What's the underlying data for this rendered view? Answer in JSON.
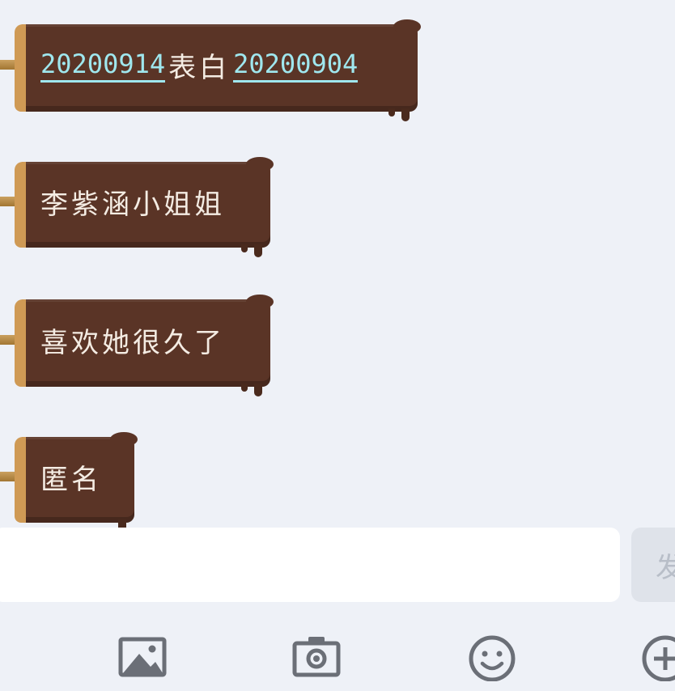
{
  "messages": [
    {
      "parts": [
        {
          "text": "20200914",
          "kind": "link"
        },
        {
          "text": "表白",
          "kind": "plain"
        },
        {
          "text": "20200904",
          "kind": "link"
        }
      ]
    },
    {
      "text": "李紫涵小姐姐"
    },
    {
      "text": "喜欢她很久了"
    },
    {
      "text": "匿名"
    }
  ],
  "input": {
    "value": "",
    "send_label": "发"
  },
  "toolbar": [
    "image-icon",
    "camera-icon",
    "emoji-icon",
    "plus-icon"
  ],
  "colors": {
    "bubble": "#5a3426",
    "stick": "#cf9a55",
    "link": "#9fe7ee",
    "background": "#eef1f7"
  }
}
